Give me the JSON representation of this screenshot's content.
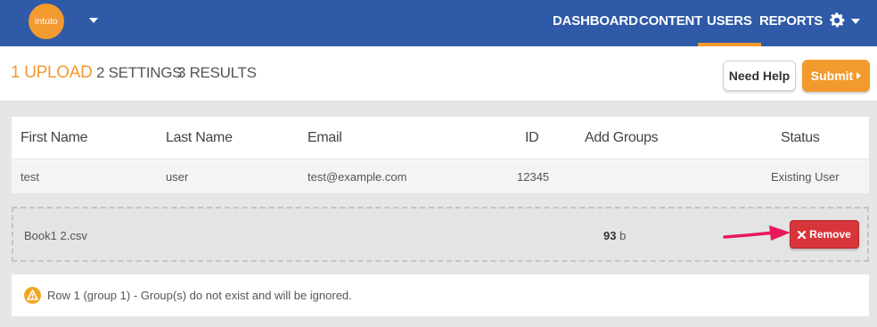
{
  "header": {
    "logo_text": "intuto",
    "nav": [
      {
        "label": "DASHBOARD",
        "active": false
      },
      {
        "label": "CONTENT",
        "active": false
      },
      {
        "label": "USERS",
        "active": true
      },
      {
        "label": "REPORTS",
        "active": false
      }
    ],
    "accent_color": "#f39a2f",
    "bar_color": "#2e5aa8"
  },
  "steps": [
    {
      "label": "1 UPLOAD",
      "active": true
    },
    {
      "label": "2 SETTINGS",
      "active": false
    },
    {
      "label": "3 RESULTS",
      "active": false
    }
  ],
  "actions": {
    "help_label": "Need Help",
    "submit_label": "Submit"
  },
  "table": {
    "columns": [
      "First Name",
      "Last Name",
      "Email",
      "ID",
      "Add Groups",
      "Status"
    ],
    "rows": [
      {
        "first_name": "test",
        "last_name": "user",
        "email": "test@example.com",
        "id": "12345",
        "groups": "",
        "status": "Existing User"
      }
    ]
  },
  "file": {
    "name": "Book1 2.csv",
    "size_value": "93",
    "size_unit": "b",
    "remove_label": "Remove",
    "remove_color": "#d8353b"
  },
  "warning": {
    "text": "Row 1 (group 1) - Group(s) do not exist and will be ignored.",
    "icon": "warning-icon",
    "color": "#f0a724"
  }
}
